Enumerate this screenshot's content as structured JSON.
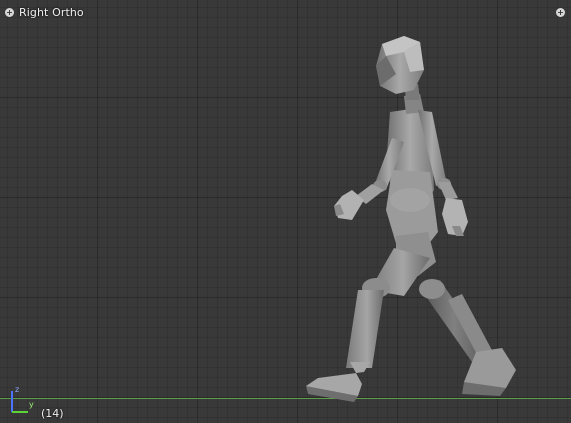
{
  "viewport": {
    "view_name": "Right Ortho",
    "frame_indicator": "(14)",
    "background_color": "#393939",
    "ground_line_color": "#5ea04a"
  },
  "header": {
    "left_toggle_icon": "plus-circle-icon",
    "right_toggle_icon": "plus-circle-icon",
    "toggle_glyph": "+"
  },
  "axis_gizmo": {
    "z_label": "z",
    "y_label": "y",
    "z_color": "#4a74ff",
    "y_color": "#5dd33a"
  },
  "scene": {
    "object": "humanoid mannequin walking"
  }
}
